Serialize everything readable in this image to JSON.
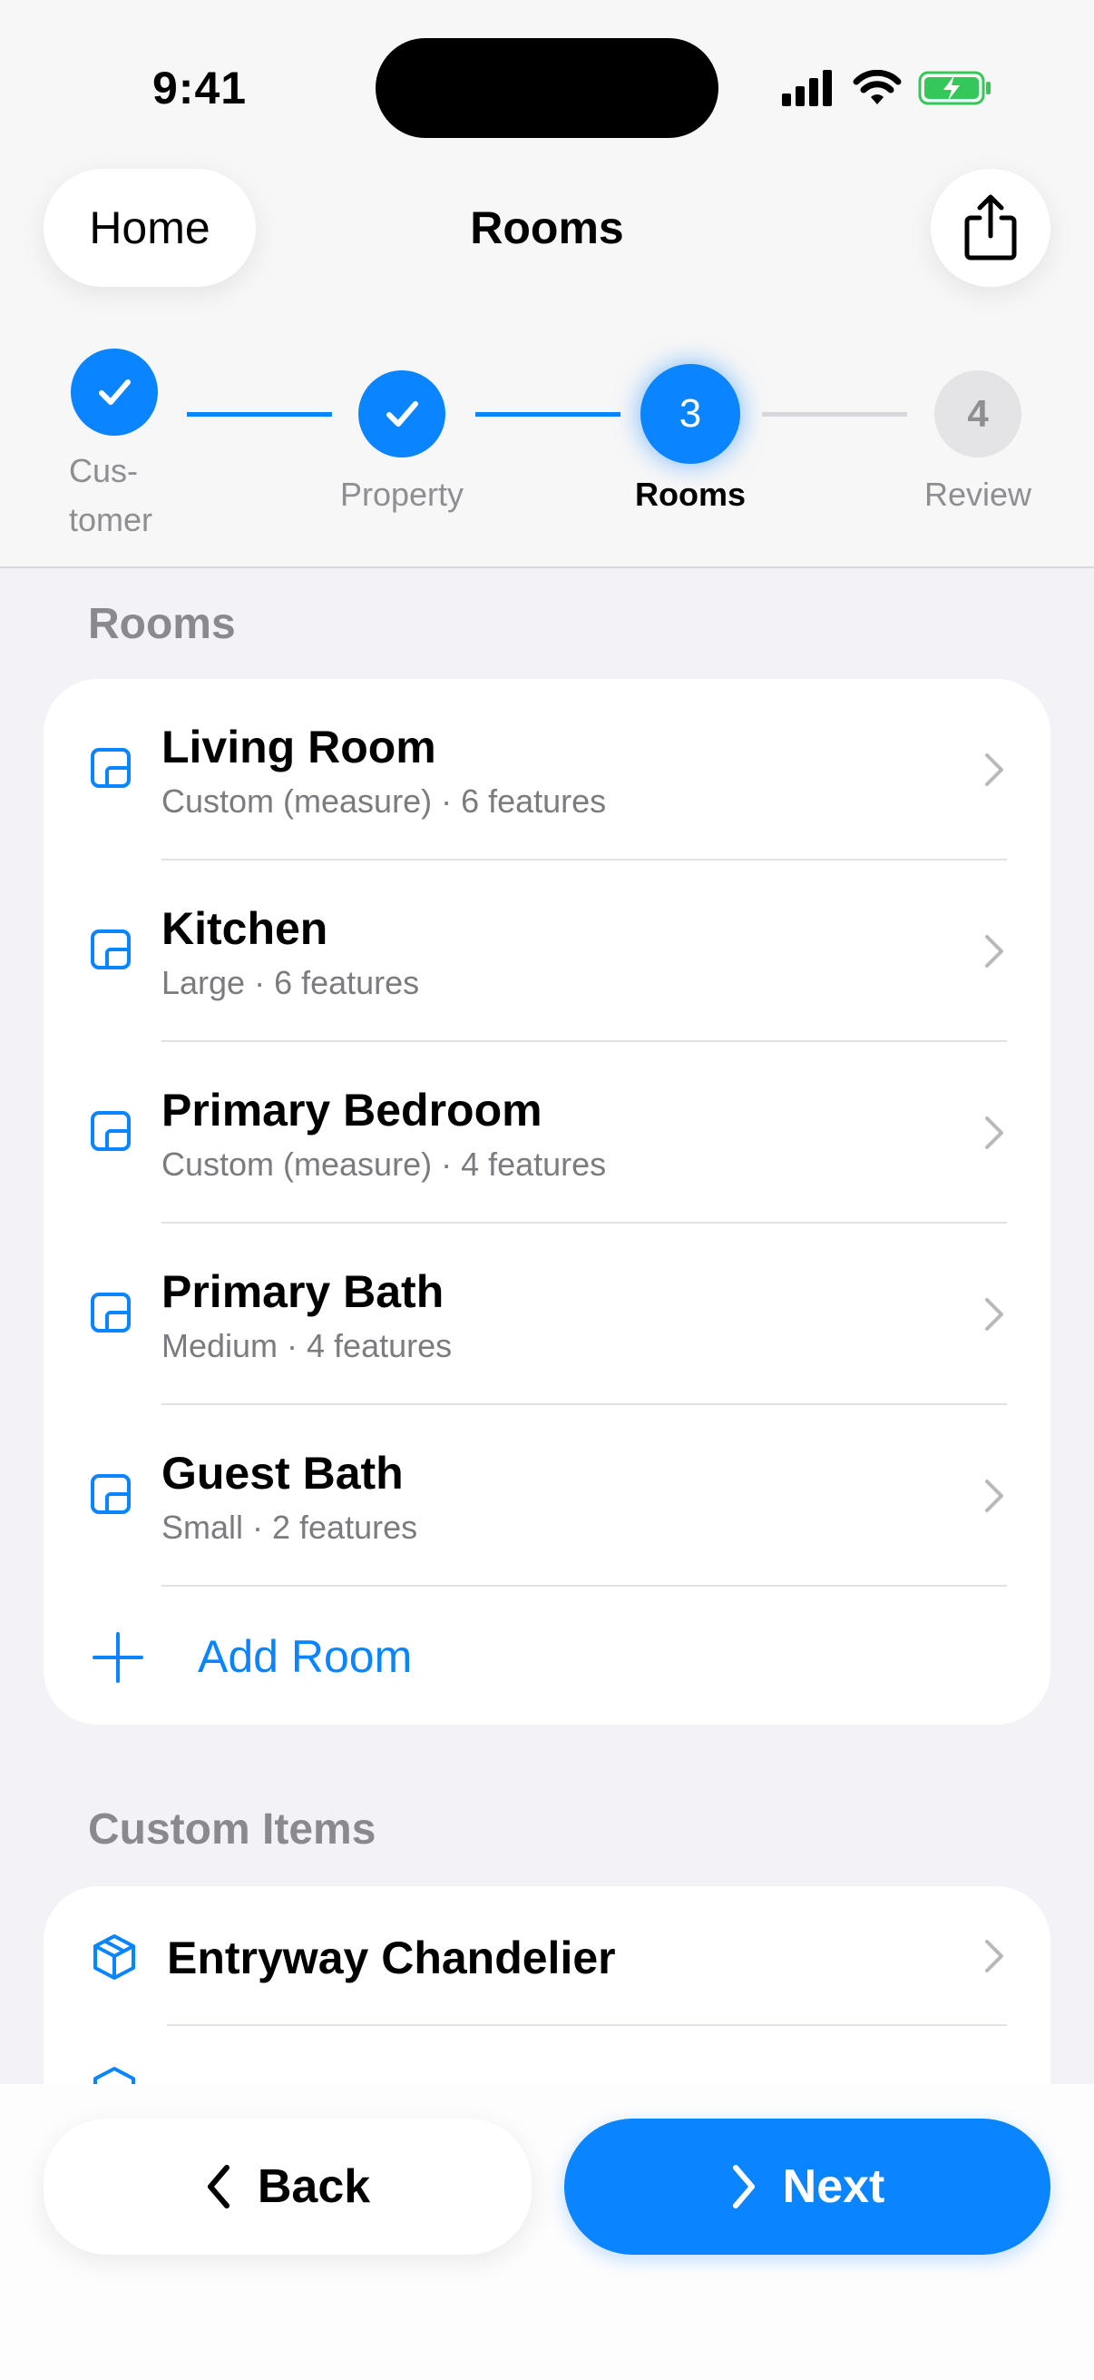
{
  "status_bar": {
    "time": "9:41"
  },
  "nav": {
    "back_label": "Home",
    "title": "Rooms",
    "share_icon": "share-icon"
  },
  "stepper": {
    "steps": [
      {
        "label_line1": "Cus-",
        "label_line2": "tomer",
        "state": "done"
      },
      {
        "label": "Property",
        "state": "done"
      },
      {
        "number": "3",
        "label": "Rooms",
        "state": "active"
      },
      {
        "number": "4",
        "label": "Review",
        "state": "pending"
      }
    ]
  },
  "rooms_section": {
    "header": "Rooms",
    "items": [
      {
        "name": "Living Room",
        "detail": "Custom (measure) · 6 features"
      },
      {
        "name": "Kitchen",
        "detail": "Large · 6 features"
      },
      {
        "name": "Primary Bedroom",
        "detail": "Custom (measure) · 4 features"
      },
      {
        "name": "Primary Bath",
        "detail": "Medium · 4 features"
      },
      {
        "name": "Guest Bath",
        "detail": "Small · 2 features"
      }
    ],
    "add_label": "Add Room"
  },
  "custom_section": {
    "header": "Custom Items",
    "items": [
      {
        "name": "Entryway Chandelier"
      }
    ]
  },
  "footer": {
    "back_label": "Back",
    "next_label": "Next"
  },
  "colors": {
    "accent": "#0a84ff",
    "background": "#f2f2f7",
    "battery": "#34c759"
  }
}
